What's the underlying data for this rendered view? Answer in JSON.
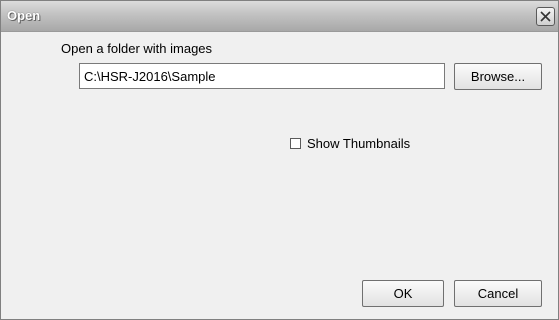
{
  "window": {
    "title": "Open",
    "close_icon": "close-icon"
  },
  "folder": {
    "label": "Open a folder with images",
    "path_value": "C:\\HSR-J2016\\Sample",
    "browse_label": "Browse..."
  },
  "thumbnails": {
    "label": "Show Thumbnails",
    "checked": false
  },
  "footer": {
    "ok_label": "OK",
    "cancel_label": "Cancel"
  }
}
